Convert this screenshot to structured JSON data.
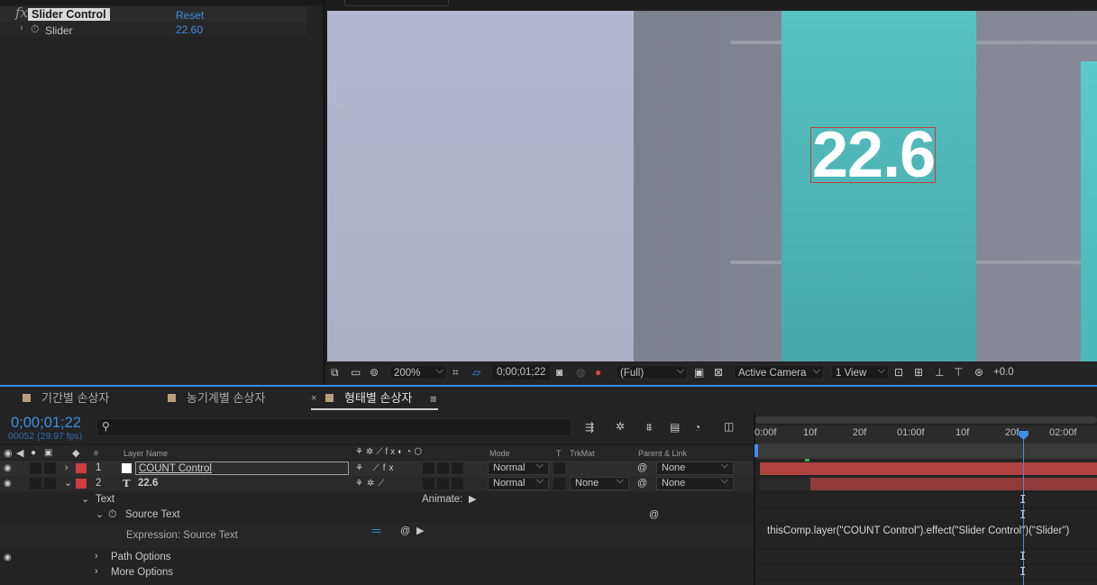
{
  "effect_controls": {
    "effect_name": "Slider Control",
    "reset_label": "Reset",
    "param_name": "Slider",
    "param_value": "22.60"
  },
  "viewer": {
    "comp_text": "22.6",
    "zoom": "200%",
    "timecode": "0;00;01;22",
    "resolution": "(Full)",
    "camera": "Active Camera",
    "views": "1 View",
    "exposure": "+0.0"
  },
  "tabs": [
    {
      "label": "기간별 손상자"
    },
    {
      "label": "농기계별 손상자"
    },
    {
      "label": "형태별 손상자"
    }
  ],
  "timeline": {
    "timecode": "0;00;01;22",
    "frames": "00052 (29.97 fps)",
    "columns": {
      "hash": "#",
      "layer_name": "Layer Name",
      "mode": "Mode",
      "t": "T",
      "trkmat": "TrkMat",
      "parent": "Parent & Link"
    },
    "layers": [
      {
        "num": "1",
        "name": "COUNT Control",
        "mode": "Normal",
        "trkmat": "",
        "parent": "None"
      },
      {
        "num": "2",
        "name": "22.6",
        "type_glyph": "T",
        "mode": "Normal",
        "trkmat": "None",
        "parent": "None"
      }
    ],
    "props": {
      "text": "Text",
      "animate": "Animate:",
      "source_text": "Source Text",
      "expression": "Expression: Source Text",
      "path_options": "Path Options",
      "more_options": "More Options"
    },
    "ruler": [
      "0:00f",
      "10f",
      "20f",
      "01:00f",
      "10f",
      "20f",
      "02:00f"
    ],
    "expression_code": "thisComp.layer(\"COUNT Control\").effect(\"Slider Control\")(\"Slider\")"
  },
  "colors": {
    "accent": "#3f8fe4",
    "label_red": "#cf3f3f",
    "teal": "#4fb6b7"
  }
}
